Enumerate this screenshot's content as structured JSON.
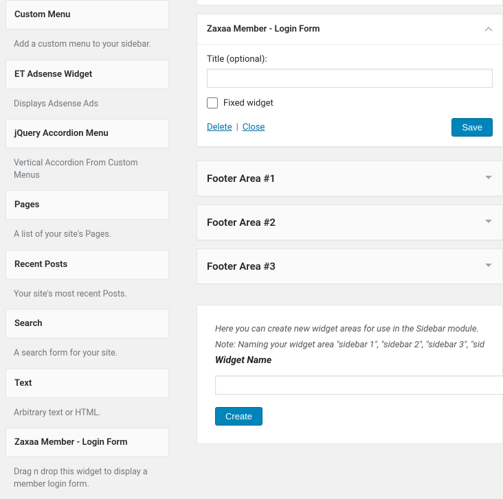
{
  "available_widgets": [
    {
      "title": "Custom Menu",
      "desc": "Add a custom menu to your sidebar."
    },
    {
      "title": "ET Adsense Widget",
      "desc": "Displays Adsense Ads"
    },
    {
      "title": "jQuery Accordion Menu",
      "desc": "Vertical Accordion From Custom Menus"
    },
    {
      "title": "Pages",
      "desc": "A list of your site's Pages."
    },
    {
      "title": "Recent Posts",
      "desc": "Your site's most recent Posts."
    },
    {
      "title": "Search",
      "desc": "A search form for your site."
    },
    {
      "title": "Text",
      "desc": "Arbitrary text or HTML."
    },
    {
      "title": "Zaxaa Member - Login Form",
      "desc": "Drag n drop this widget to display a member login form."
    }
  ],
  "open_widget": {
    "title": "Zaxaa Member - Login Form",
    "field_label": "Title (optional):",
    "field_value": "",
    "fixed_label": "Fixed widget",
    "fixed_checked": false,
    "delete": "Delete",
    "close": "Close",
    "save": "Save"
  },
  "areas": [
    "Footer Area #1",
    "Footer Area #2",
    "Footer Area #3"
  ],
  "create_panel": {
    "hint1": "Here you can create new widget areas for use in the Sidebar module.",
    "hint2": "Note: Naming your widget area \"sidebar 1\", \"sidebar 2\", \"sidebar 3\", \"sid",
    "label": "Widget Name",
    "value": "",
    "button": "Create"
  }
}
